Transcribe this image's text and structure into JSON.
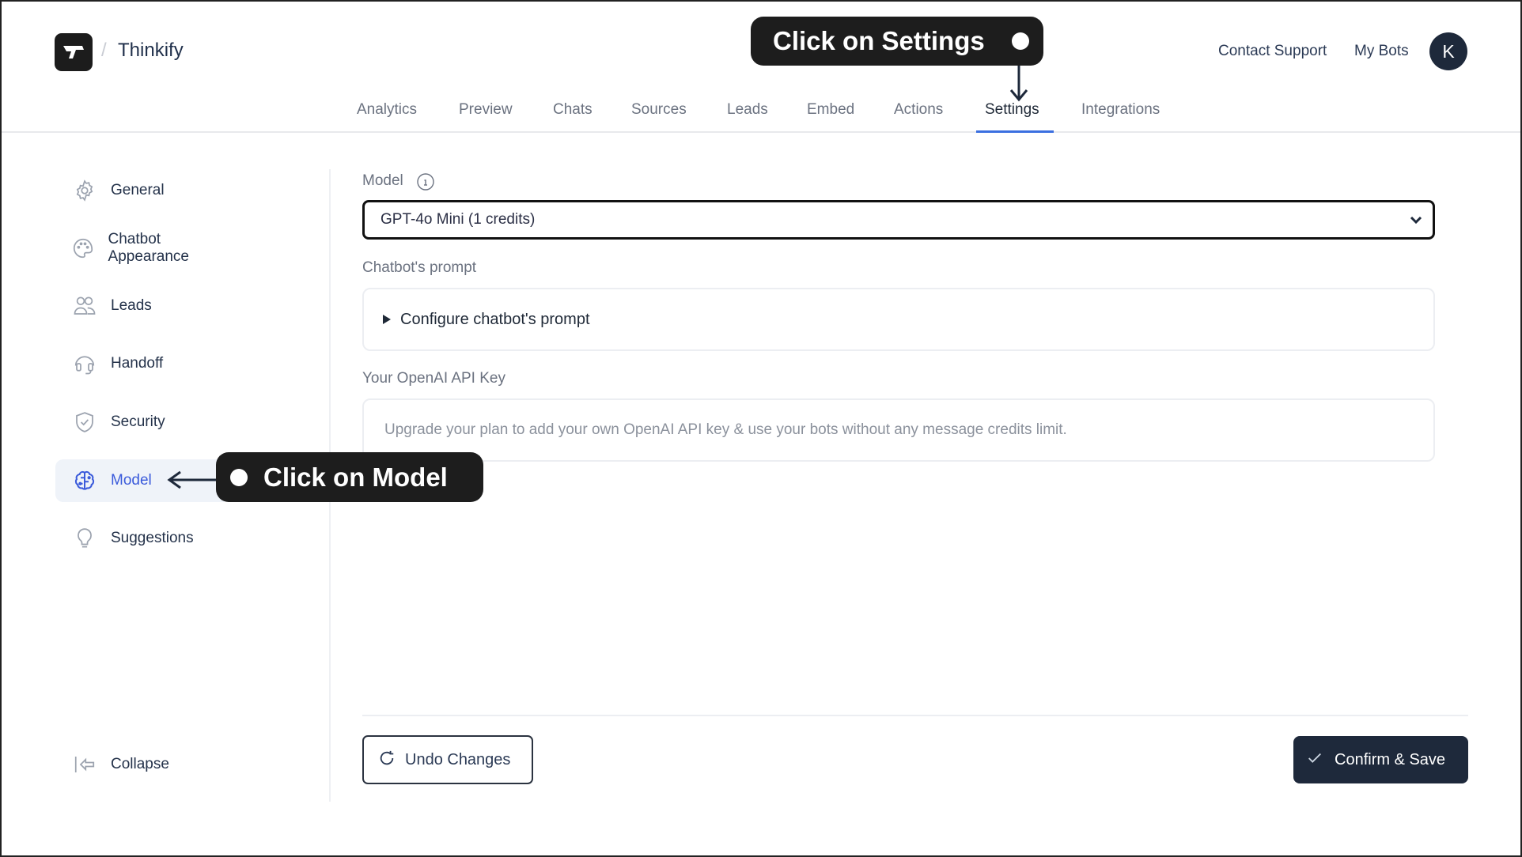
{
  "header": {
    "app_name": "Thinkify",
    "breadcrumb_separator": "/",
    "logo_icon": "thinkify-logo-icon",
    "links": [
      {
        "label": "Contact Support"
      },
      {
        "label": "My Bots"
      }
    ],
    "avatar_initial": "K"
  },
  "tabs": [
    {
      "label": "Analytics",
      "active": false
    },
    {
      "label": "Preview",
      "active": false
    },
    {
      "label": "Chats",
      "active": false
    },
    {
      "label": "Sources",
      "active": false
    },
    {
      "label": "Leads",
      "active": false
    },
    {
      "label": "Embed",
      "active": false
    },
    {
      "label": "Actions",
      "active": false
    },
    {
      "label": "Settings",
      "active": true
    },
    {
      "label": "Integrations",
      "active": false
    }
  ],
  "sidebar": {
    "items": [
      {
        "label": "General",
        "icon": "gear-icon",
        "active": false
      },
      {
        "label": "Chatbot Appearance",
        "icon": "palette-icon",
        "active": false
      },
      {
        "label": "Leads",
        "icon": "users-icon",
        "active": false
      },
      {
        "label": "Handoff",
        "icon": "headset-icon",
        "active": false
      },
      {
        "label": "Security",
        "icon": "shield-check-icon",
        "active": false
      },
      {
        "label": "Model",
        "icon": "brain-icon",
        "active": true
      },
      {
        "label": "Suggestions",
        "icon": "lightbulb-icon",
        "active": false
      }
    ],
    "collapse_label": "Collapse"
  },
  "main": {
    "model_label": "Model",
    "model_info_icon": "info-icon",
    "model_selected": "GPT-4o Mini (1 credits)",
    "prompt_label": "Chatbot's prompt",
    "prompt_summary": "Configure chatbot's prompt",
    "api_key_label": "Your OpenAI API Key",
    "api_key_message": "Upgrade your plan to add your own OpenAI API key & use your bots without any message credits limit.",
    "undo_label": "Undo Changes",
    "save_label": "Confirm & Save"
  },
  "annotations": {
    "settings_callout": "Click on Settings",
    "model_callout": "Click on Model"
  },
  "colors": {
    "accent": "#3b6fe0",
    "active_item_text": "#3b5bdb",
    "active_item_bg": "#eff3f9",
    "primary_button": "#1e293b",
    "callout_bg": "#1d1d1d"
  }
}
